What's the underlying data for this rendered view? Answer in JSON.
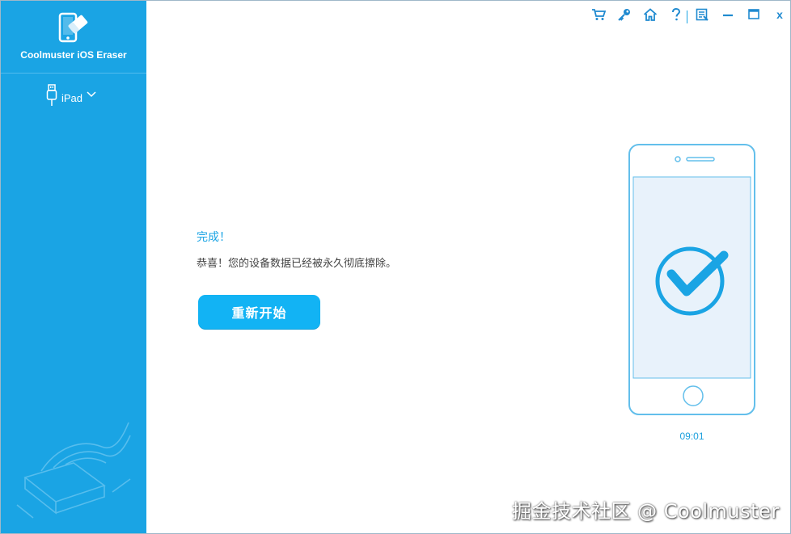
{
  "app": {
    "title": "Coolmuster iOS Eraser"
  },
  "sidebar": {
    "device": {
      "name": "iPad"
    }
  },
  "toolbar": {
    "icons": [
      "cart-icon",
      "key-icon",
      "home-icon",
      "help-icon",
      "feedback-icon",
      "minimize-icon",
      "maximize-icon",
      "close-icon"
    ],
    "close_label": "x"
  },
  "main": {
    "status_title": "完成！",
    "status_message": "恭喜！您的设备数据已经被永久彻底擦除。",
    "restart_button": "重新开始"
  },
  "phone": {
    "time": "09:01"
  },
  "watermark": {
    "text": "掘金技术社区 @ Coolmuster"
  },
  "colors": {
    "sidebar": "#1aa4e4",
    "accent": "#12b3f4",
    "icon": "#1f8ad0"
  }
}
